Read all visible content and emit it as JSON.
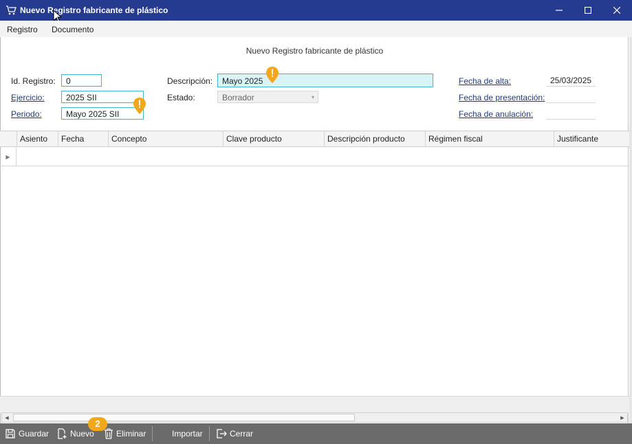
{
  "window": {
    "title": "Nuevo Registro fabricante de plástico",
    "controls": {
      "minimize": "—",
      "maximize": "☐",
      "close": "✕"
    }
  },
  "menu": {
    "items": [
      "Registro",
      "Documento"
    ]
  },
  "form": {
    "title": "Nuevo Registro fabricante de plástico",
    "id_registro": {
      "label": "Id. Registro:",
      "value": "0"
    },
    "ejercicio": {
      "label": "Ejercicio:",
      "value": "2025 SII"
    },
    "periodo": {
      "label": "Periodo:",
      "value": "Mayo 2025 SII"
    },
    "descripcion": {
      "label": "Descripción:",
      "value": "Mayo 2025"
    },
    "estado": {
      "label": "Estado:",
      "value": "Borrador"
    },
    "fecha_alta": {
      "label": "Fecha de alta:",
      "value": "25/03/2025"
    },
    "fecha_presentacion": {
      "label": "Fecha de presentación:",
      "value": ""
    },
    "fecha_anulacion": {
      "label": "Fecha de anulación:",
      "value": ""
    }
  },
  "grid": {
    "columns": [
      "Asiento",
      "Fecha",
      "Concepto",
      "Clave producto",
      "Descripción producto",
      "Régimen fiscal",
      "Justificante"
    ]
  },
  "toolbar": {
    "guardar": "Guardar",
    "nuevo": "Nuevo",
    "eliminar": "Eliminar",
    "importar": "Importar",
    "cerrar": "Cerrar",
    "badge": "2"
  },
  "colors": {
    "titlebar": "#253b8f",
    "accent_border": "#3fb7c8",
    "warning": "#f3a81b",
    "toolbar": "#6b6b6b"
  }
}
